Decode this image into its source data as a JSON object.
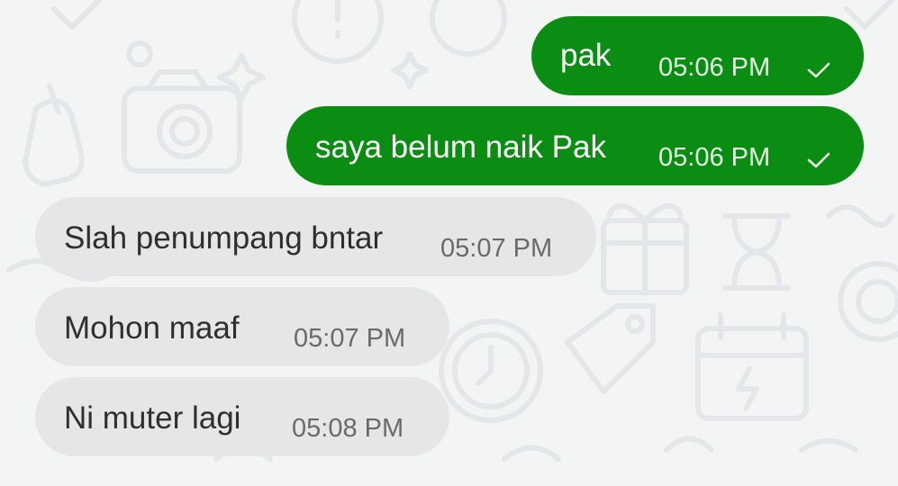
{
  "messages": [
    {
      "direction": "outgoing",
      "text": "pak",
      "time": "05:06 PM",
      "status_icon": "single-check-icon"
    },
    {
      "direction": "outgoing",
      "text": "saya belum naik Pak",
      "time": "05:06 PM",
      "status_icon": "single-check-icon"
    },
    {
      "direction": "incoming",
      "text": "Slah penumpang bntar",
      "time": "05:07 PM"
    },
    {
      "direction": "incoming",
      "text": "Mohon maaf",
      "time": "05:07 PM"
    },
    {
      "direction": "incoming",
      "text": "Ni muter lagi",
      "time": "05:08 PM"
    }
  ],
  "colors": {
    "background": "#f3f4f4",
    "outgoing_bubble": "#0b8c12",
    "incoming_bubble": "#e6e6e6",
    "wallpaper_doodle": "#e4e8ea"
  }
}
